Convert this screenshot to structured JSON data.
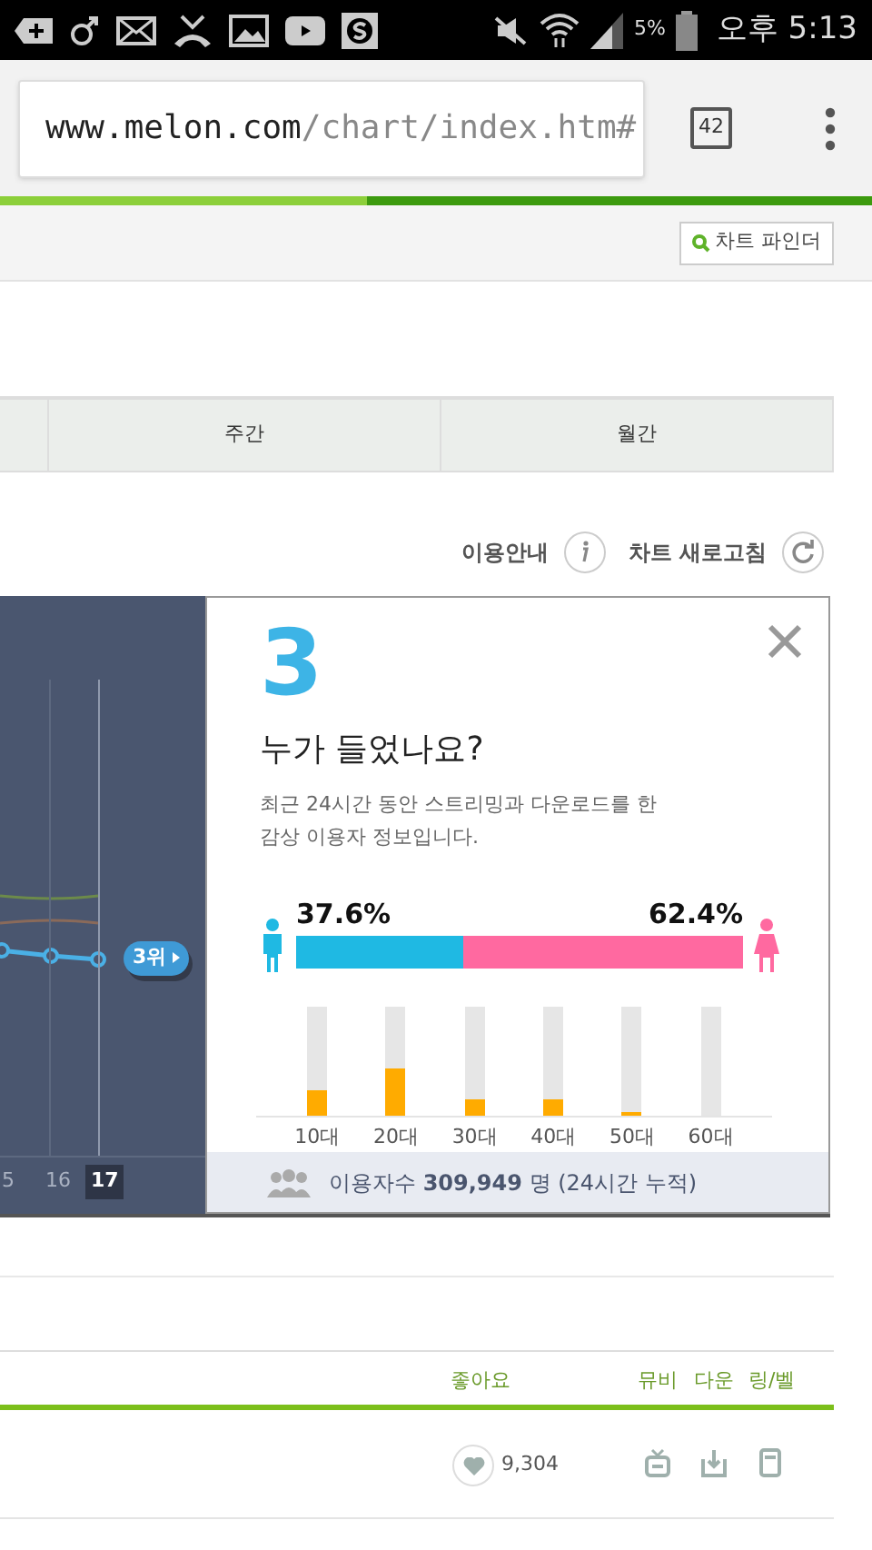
{
  "status_bar": {
    "battery": "5%",
    "time": "오후 5:13"
  },
  "browser": {
    "url_host": "www.melon.com",
    "url_path": "/chart/index.htm#",
    "tab_count": "42",
    "level": 0.42
  },
  "chart_finder_button": "차트 파인더",
  "period_tabs": [
    {
      "label": "주간",
      "selected": false
    },
    {
      "label": "월간",
      "selected": false
    }
  ],
  "links": [
    "이용안내",
    "차트 새로고침"
  ],
  "rank_chart": {
    "x_labels": [
      {
        "label": "5",
        "selected": false
      },
      {
        "label": "16",
        "selected": false
      },
      {
        "label": "17",
        "selected": true
      }
    ],
    "badge": "3위"
  },
  "popup": {
    "rank": "3",
    "title": "누가 들었나요?",
    "description_lines": [
      "최근 24시간 동안 스트리밍과 다운로드를 한",
      "감상 이용자 정보입니다."
    ],
    "male": {
      "percent": "37.6%",
      "level": 0.376
    },
    "female": {
      "percent": "62.4%"
    },
    "ages": [
      {
        "label": "10대",
        "level": 0.22
      },
      {
        "label": "20대",
        "level": 0.43
      },
      {
        "label": "30대",
        "level": 0.14
      },
      {
        "label": "40대",
        "level": 0.14
      },
      {
        "label": "50대",
        "level": 0.03
      },
      {
        "label": "60대",
        "level": 0
      }
    ],
    "footer": "이용자수 **309,949** 명 (24시간 누적)"
  },
  "table": {
    "columns": [
      "좋아요",
      "뮤비",
      "다운",
      "링/벨"
    ],
    "rows": [
      {
        "likes": "9,304"
      }
    ]
  }
}
